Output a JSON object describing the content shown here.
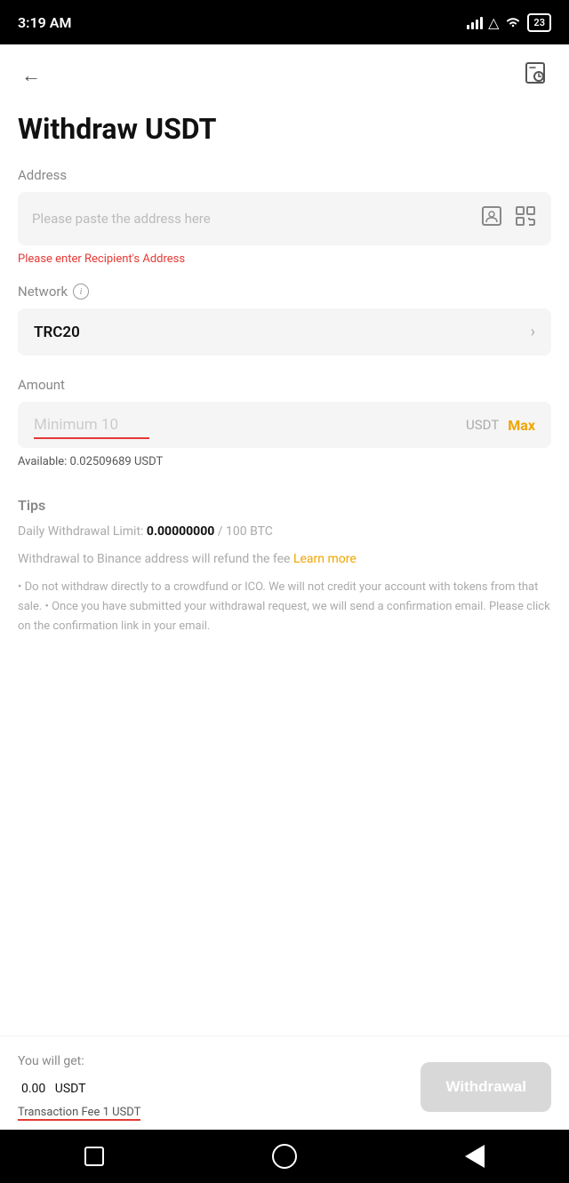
{
  "statusBar": {
    "time": "3:19 AM",
    "battery": "23"
  },
  "header": {
    "back_label": "←",
    "history_label": "⊡"
  },
  "page": {
    "title": "Withdraw USDT"
  },
  "address": {
    "label": "Address",
    "placeholder": "Please paste the address here",
    "error": "Please enter Recipient's Address"
  },
  "network": {
    "label": "Network",
    "value": "TRC20",
    "info": "i"
  },
  "amount": {
    "label": "Amount",
    "placeholder": "Minimum 10",
    "unit": "USDT",
    "max_label": "Max",
    "available_label": "Available: 0.02509689 USDT"
  },
  "tips": {
    "title": "Tips",
    "daily_limit_label": "Daily Withdrawal Limit:",
    "daily_limit_value": "0.00000000",
    "daily_limit_max": "/ 100 BTC",
    "binance_text": "Withdrawal to Binance address will refund the fee",
    "learn_more": "Learn more",
    "body": "• Do not withdraw directly to a crowdfund or ICO. We will not credit your account with tokens from that sale. • Once you have submitted your withdrawal request, we will send a confirmation email. Please click on the confirmation link in your email."
  },
  "footer": {
    "you_get_label": "You will get:",
    "amount": "0.00",
    "unit": "USDT",
    "fee_label": "Transaction Fee 1 USDT",
    "withdraw_btn": "Withdrawal"
  }
}
